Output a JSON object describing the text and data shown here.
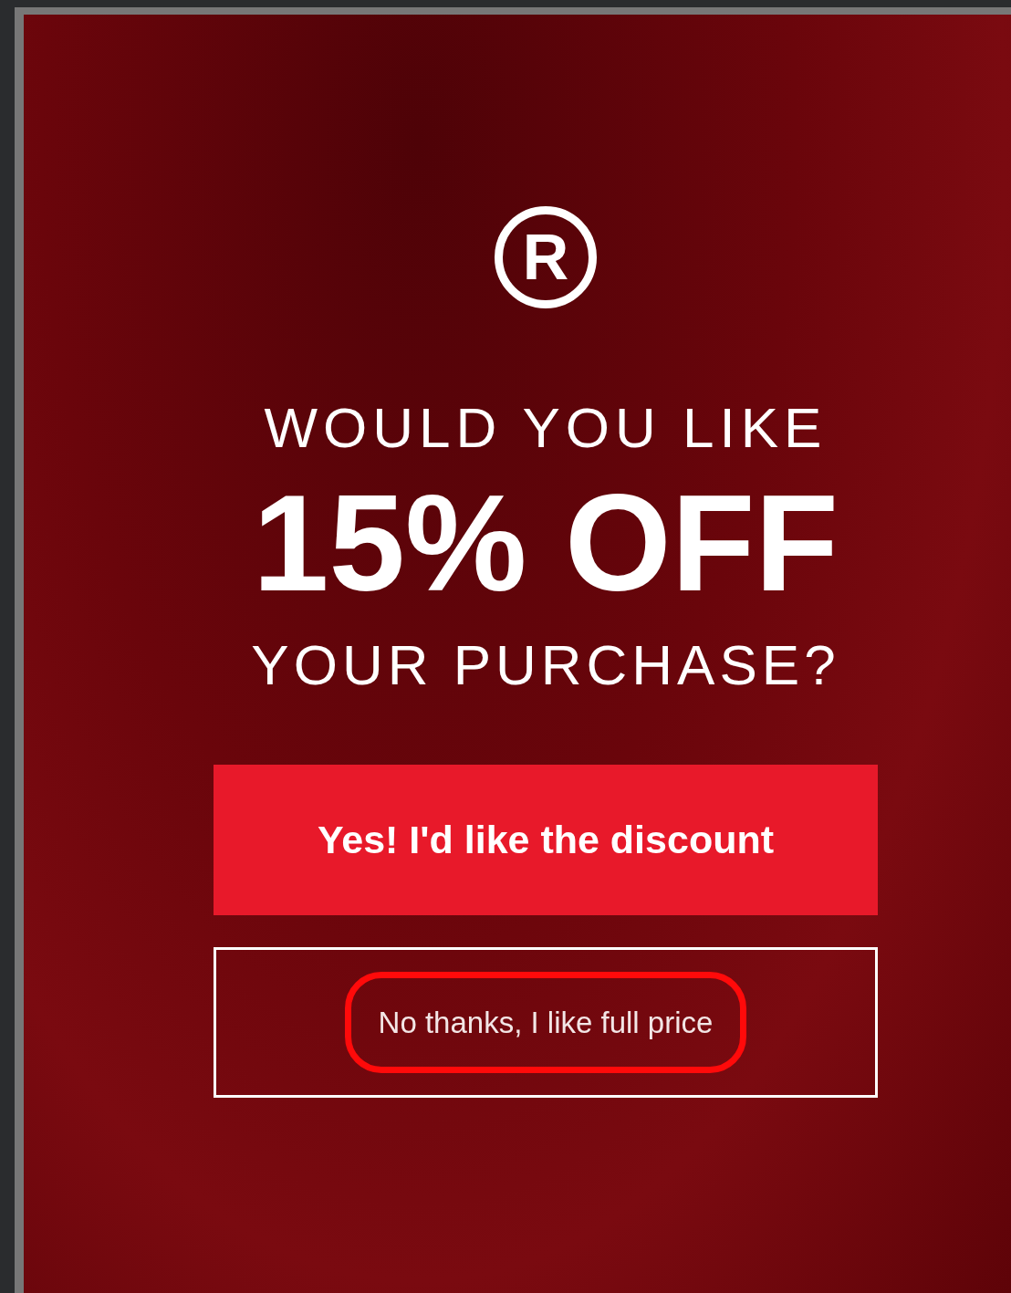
{
  "logo": {
    "letter": "R"
  },
  "headline": {
    "top": "WOULD YOU LIKE",
    "offer": "15% OFF",
    "bottom": "YOUR PURCHASE?"
  },
  "accept_button": {
    "label": "Yes! I'd like the discount"
  },
  "decline_link": {
    "label": "No thanks, I like full price",
    "highlighted": true
  }
}
